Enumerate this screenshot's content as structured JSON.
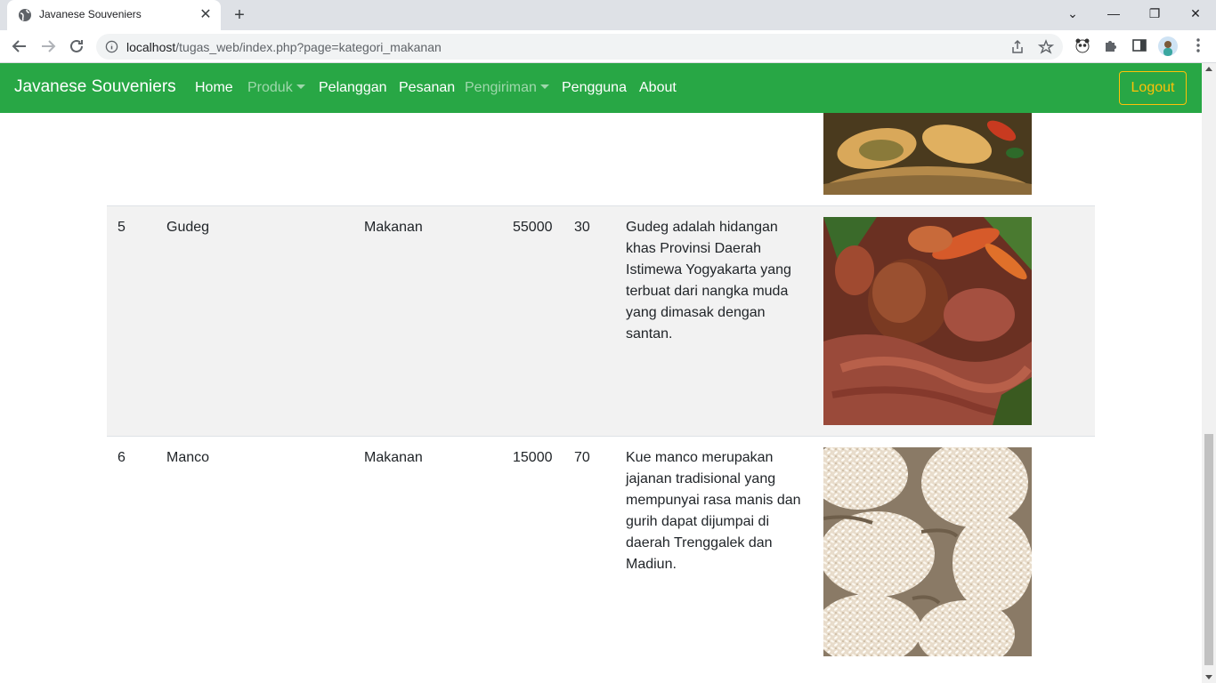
{
  "browser": {
    "tab_title": "Javanese Souveniers",
    "url_host": "localhost",
    "url_path": "/tugas_web/index.php?page=kategori_makanan"
  },
  "navbar": {
    "brand": "Javanese Souveniers",
    "links": {
      "home": "Home",
      "produk": "Produk",
      "pelanggan": "Pelanggan",
      "pesanan": "Pesanan",
      "pengiriman": "Pengiriman",
      "pengguna": "Pengguna",
      "about": "About"
    },
    "logout": "Logout",
    "colors": {
      "background": "#28a745",
      "logout": "#ffc107"
    }
  },
  "table": {
    "rows": [
      {
        "no": "5",
        "name": "Gudeg",
        "category": "Makanan",
        "price": "55000",
        "stock": "30",
        "description": "Gudeg adalah hidangan khas Provinsi Daerah Istimewa Yogyakarta yang terbuat dari nangka muda yang dimasak dengan santan.",
        "image": "gudeg-photo"
      },
      {
        "no": "6",
        "name": "Manco",
        "category": "Makanan",
        "price": "15000",
        "stock": "70",
        "description": "Kue manco merupakan jajanan tradisional yang mempunyai rasa manis dan gurih dapat dijumpai di daerah Trenggalek dan Madiun.",
        "image": "manco-photo"
      }
    ]
  }
}
